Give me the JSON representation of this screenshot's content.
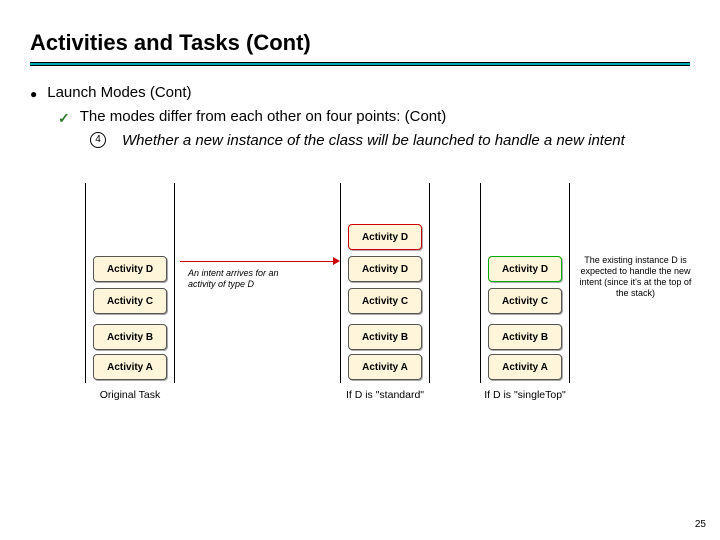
{
  "title": "Activities and Tasks (Cont)",
  "bullets": {
    "main": "Launch Modes (Cont)",
    "sub1": "The modes differ from each other on four points: (Cont)",
    "sub2_num": "4",
    "sub2": "Whether a new instance of the class will be launched to handle a new intent"
  },
  "stacks": {
    "original": {
      "caption": "Original Task",
      "boxes": [
        "Activity D",
        "Activity C",
        "Activity B",
        "Activity A"
      ]
    },
    "intent_label": "An intent arrives for an activity of type D",
    "standard": {
      "caption": "If D is \"standard\"",
      "boxes": [
        "Activity D",
        "Activity D",
        "Activity C",
        "Activity B",
        "Activity A"
      ]
    },
    "singleTop": {
      "caption": "If D is \"singleTop\"",
      "boxes": [
        "Activity D",
        "Activity C",
        "Activity B",
        "Activity A"
      ]
    }
  },
  "note": "The existing instance D is expected to handle the new intent (since it's at the top of the stack)",
  "page_number": "25"
}
